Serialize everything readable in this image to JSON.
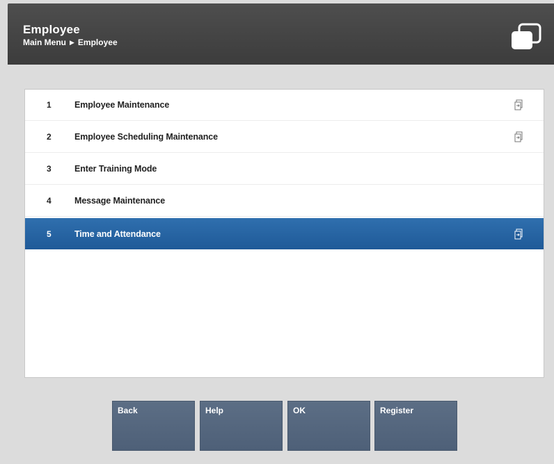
{
  "header": {
    "title": "Employee",
    "breadcrumb": [
      "Main Menu",
      "Employee"
    ],
    "breadcrumb_separator": "▶"
  },
  "menu": {
    "selected_index": 4,
    "items": [
      {
        "number": "1",
        "label": "Employee Maintenance",
        "has_submenu": true
      },
      {
        "number": "2",
        "label": "Employee Scheduling Maintenance",
        "has_submenu": true
      },
      {
        "number": "3",
        "label": "Enter Training Mode",
        "has_submenu": false
      },
      {
        "number": "4",
        "label": "Message Maintenance",
        "has_submenu": false
      },
      {
        "number": "5",
        "label": "Time and Attendance",
        "has_submenu": true
      }
    ]
  },
  "buttons": {
    "back": "Back",
    "help": "Help",
    "ok": "OK",
    "register": "Register"
  },
  "colors": {
    "header_bg": "#444444",
    "selected_row": "#2667a5",
    "button_bg": "#56687f"
  }
}
